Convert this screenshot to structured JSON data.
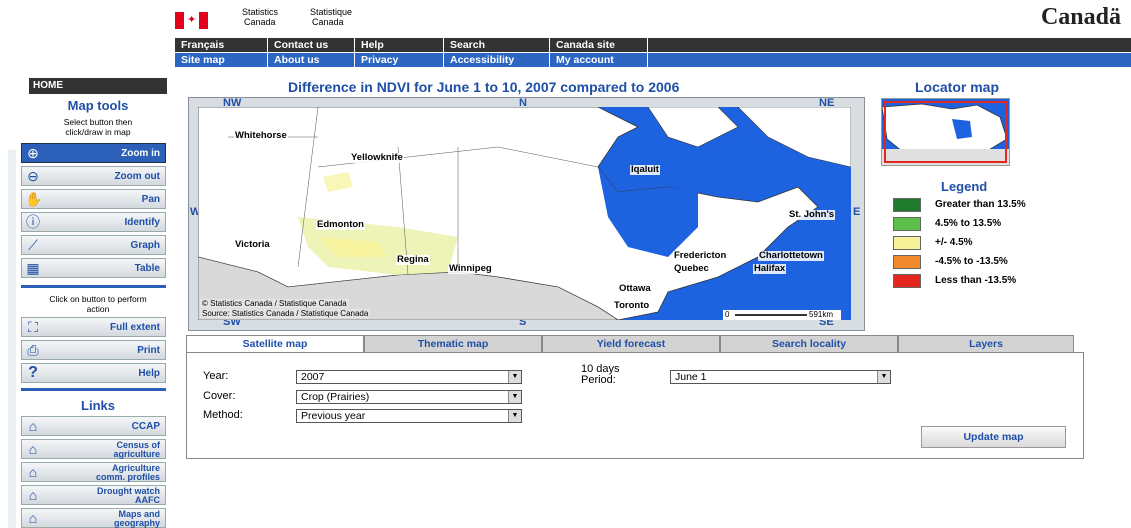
{
  "header": {
    "agency_en": [
      "Statistics",
      "Canada"
    ],
    "agency_fr": [
      "Statistique",
      "Canada"
    ],
    "wordmark": "Canadä",
    "nav_row1": [
      "Français",
      "Contact us",
      "Help",
      "Search",
      "Canada site"
    ],
    "nav_row2": [
      "Site map",
      "About us",
      "Privacy",
      "Accessibility",
      "My account"
    ]
  },
  "sidebar": {
    "home": "HOME",
    "map_tools_title": "Map tools",
    "map_tools_note": [
      "Select button then",
      "click/draw in map"
    ],
    "tools": [
      {
        "label": "Zoom in",
        "icon": "zoom-in-icon",
        "active": true
      },
      {
        "label": "Zoom out",
        "icon": "zoom-out-icon"
      },
      {
        "label": "Pan",
        "icon": "hand-icon"
      },
      {
        "label": "Identify",
        "icon": "info-icon"
      },
      {
        "label": "Graph",
        "icon": "graph-icon"
      },
      {
        "label": "Table",
        "icon": "table-icon"
      }
    ],
    "action_note": [
      "Click on button to perform",
      "action"
    ],
    "actions": [
      {
        "label": "Full extent",
        "icon": "full-extent-icon"
      },
      {
        "label": "Print",
        "icon": "printer-icon"
      },
      {
        "label": "Help",
        "icon": "question-icon"
      }
    ],
    "links_title": "Links",
    "links": [
      {
        "label": [
          "CCAP"
        ]
      },
      {
        "label": [
          "Census of",
          "agriculture"
        ]
      },
      {
        "label": [
          "Agriculture",
          "comm. profiles"
        ]
      },
      {
        "label": [
          "Drought watch",
          "AAFC"
        ]
      },
      {
        "label": [
          "Maps and",
          "geography"
        ]
      }
    ]
  },
  "map": {
    "title": "Difference in NDVI for June 1 to 10, 2007 compared to 2006",
    "directions": {
      "nw": "NW",
      "n": "N",
      "ne": "NE",
      "w": "W",
      "e": "E",
      "sw": "SW",
      "s": "S",
      "se": "SE"
    },
    "cities": [
      "Whitehorse",
      "Yellowknife",
      "Iqaluit",
      "Edmonton",
      "Victoria",
      "Regina",
      "Winnipeg",
      "St. John's",
      "Fredericton",
      "Charlottetown",
      "Quebec",
      "Halifax",
      "Ottawa",
      "Toronto"
    ],
    "copyright": "© Statistics Canada / Statistique Canada",
    "source": "Source: Statistics Canada / Statistique Canada",
    "scale_start": "0",
    "scale_end": "591km"
  },
  "locator": {
    "title": "Locator map"
  },
  "legend": {
    "title": "Legend",
    "items": [
      {
        "label": "Greater than 13.5%",
        "color": "#1f7a2e"
      },
      {
        "label": "4.5% to 13.5%",
        "color": "#5bbf4a"
      },
      {
        "label": "+/- 4.5%",
        "color": "#f6f29a"
      },
      {
        "label": "-4.5% to -13.5%",
        "color": "#f08a2c"
      },
      {
        "label": "Less than -13.5%",
        "color": "#e3261e"
      }
    ]
  },
  "tabs": [
    "Satellite map",
    "Thematic map",
    "Yield forecast",
    "Search locality",
    "Layers"
  ],
  "form": {
    "year_label": "Year:",
    "year_value": "2007",
    "cover_label": "Cover:",
    "cover_value": "Crop (Prairies)",
    "method_label": "Method:",
    "method_value": "Previous year",
    "period_label": [
      "10 days",
      "Period:"
    ],
    "period_value": "June 1",
    "update_button": "Update map"
  }
}
